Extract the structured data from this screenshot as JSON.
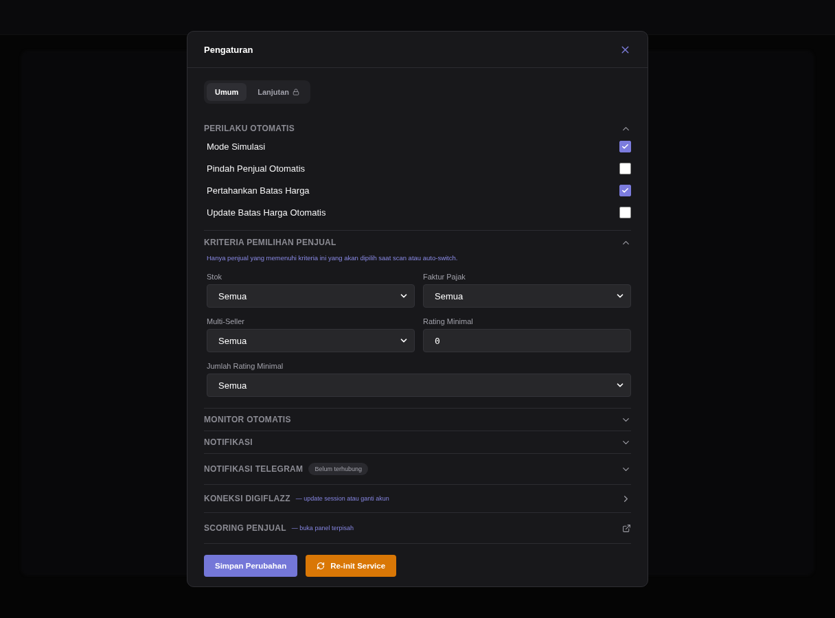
{
  "dialog": {
    "title": "Pengaturan"
  },
  "tabs": [
    {
      "label": "Umum",
      "selected": true,
      "locked": false
    },
    {
      "label": "Lanjutan",
      "selected": false,
      "locked": true
    }
  ],
  "sections": [
    {
      "kind": "toggles",
      "title": "PERILAKU OTOMATIS",
      "expanded": true,
      "items": [
        {
          "label": "Mode Simulasi",
          "checked": true
        },
        {
          "label": "Pindah Penjual Otomatis",
          "checked": false
        },
        {
          "label": "Pertahankan Batas Harga",
          "checked": true
        },
        {
          "label": "Update Batas Harga Otomatis",
          "checked": false
        }
      ]
    },
    {
      "kind": "form",
      "title": "KRITERIA PEMILIHAN PENJUAL",
      "expanded": true,
      "note": "Hanya penjual yang memenuhi kriteria ini yang akan dipilih saat scan atau auto-switch.",
      "fields": [
        {
          "label": "Stok",
          "kind": "select",
          "value": "Semua",
          "wide": false
        },
        {
          "label": "Faktur Pajak",
          "kind": "select",
          "value": "Semua",
          "wide": false
        },
        {
          "label": "Multi-Seller",
          "kind": "select",
          "value": "Semua",
          "wide": false
        },
        {
          "label": "Rating Minimal",
          "kind": "number",
          "value": "0",
          "wide": false
        },
        {
          "label": "Jumlah Rating Minimal",
          "kind": "select",
          "value": "Semua",
          "wide": true
        }
      ]
    },
    {
      "kind": "collapsed",
      "title": "MONITOR OTOMATIS",
      "expanded": false
    },
    {
      "kind": "collapsed",
      "title": "NOTIFIKASI",
      "expanded": false
    },
    {
      "kind": "collapsed",
      "title": "NOTIFIKASI TELEGRAM",
      "expanded": false,
      "badge": "Belum terhubung"
    },
    {
      "kind": "nav-link",
      "title": "KONEKSI DIGIFLAZZ",
      "hint": "— update session atau ganti akun"
    },
    {
      "kind": "external-link",
      "title": "SCORING PENJUAL",
      "hint": "— buka panel terpisah"
    }
  ],
  "buttons": [
    {
      "label": "Simpan Perubahan",
      "kind": "primary"
    },
    {
      "label": "Re-init Service",
      "kind": "warning"
    }
  ]
}
